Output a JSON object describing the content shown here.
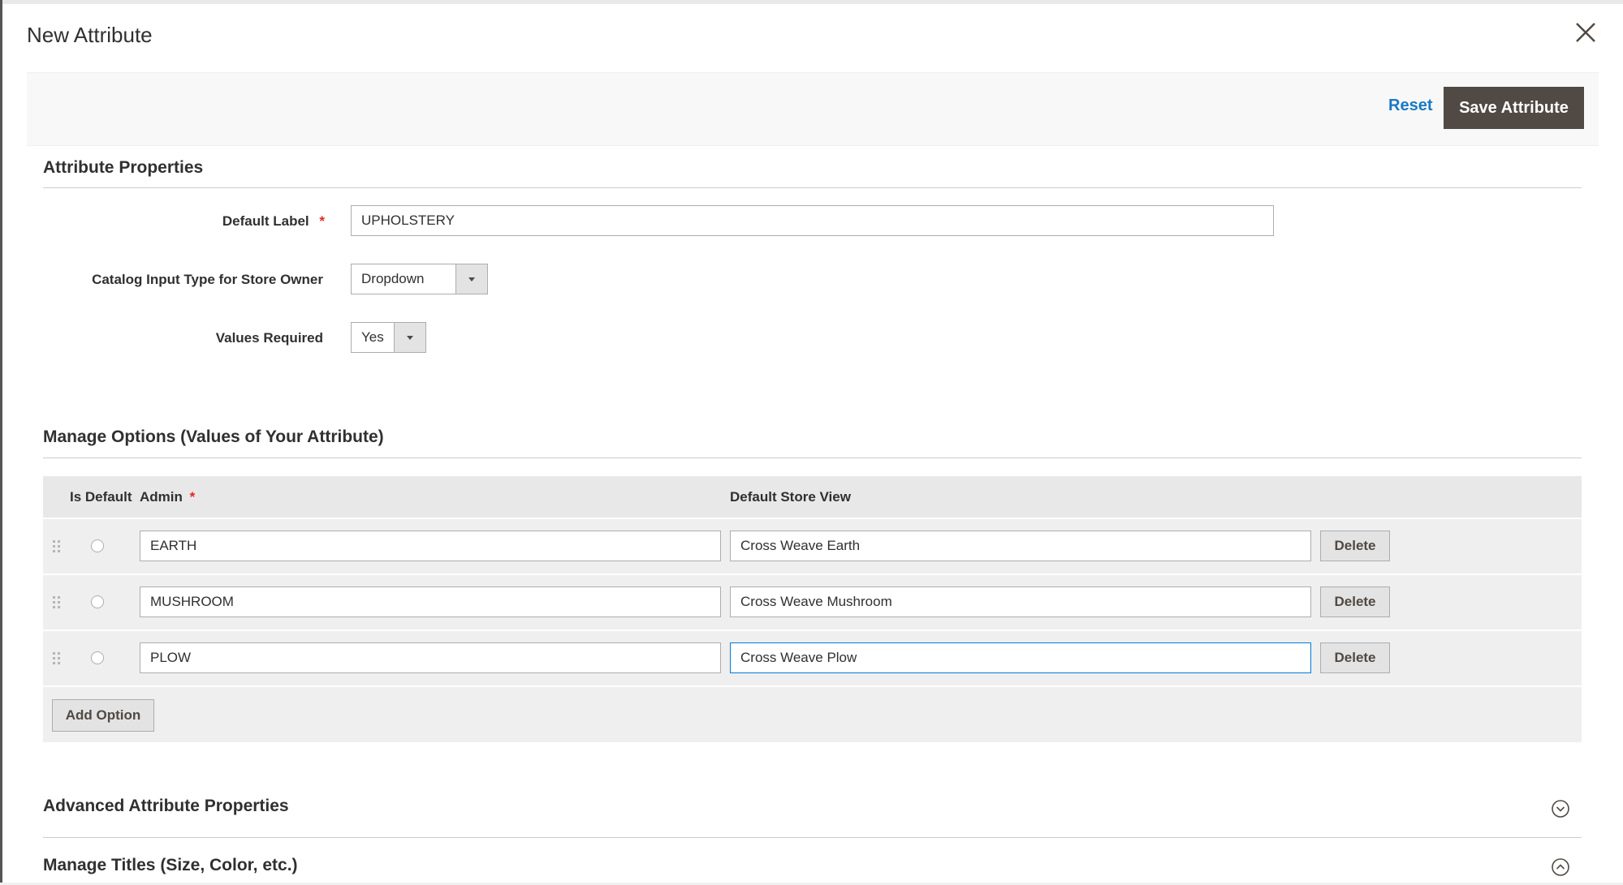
{
  "modal": {
    "title": "New Attribute",
    "close_icon": "close-icon"
  },
  "actions": {
    "reset_label": "Reset",
    "save_label": "Save Attribute",
    "save_bg": "#514943",
    "link_color": "#1979c3"
  },
  "attribute_properties": {
    "title": "Attribute Properties",
    "default_label": {
      "label": "Default Label",
      "required_mark": "*",
      "value": "UPHOLSTERY"
    },
    "input_type": {
      "label": "Catalog Input Type for Store Owner",
      "selected": "Dropdown"
    },
    "values_required": {
      "label": "Values Required",
      "selected": "Yes"
    }
  },
  "manage_options": {
    "title": "Manage Options (Values of Your Attribute)",
    "columns": {
      "is_default": "Is Default",
      "admin": "Admin",
      "admin_required_mark": "*",
      "store_view": "Default Store View"
    },
    "rows": [
      {
        "admin": "EARTH",
        "store_view": "Cross Weave Earth",
        "delete_label": "Delete"
      },
      {
        "admin": "MUSHROOM",
        "store_view": "Cross Weave Mushroom",
        "delete_label": "Delete"
      },
      {
        "admin": "PLOW",
        "store_view": "Cross Weave Plow",
        "delete_label": "Delete"
      }
    ],
    "add_option_label": "Add Option"
  },
  "sections": {
    "advanced": {
      "title": "Advanced Attribute Properties",
      "icon": "chevron-down-circle-icon"
    },
    "titles": {
      "title": "Manage Titles (Size, Color, etc.)",
      "icon": "chevron-up-circle-icon"
    }
  }
}
